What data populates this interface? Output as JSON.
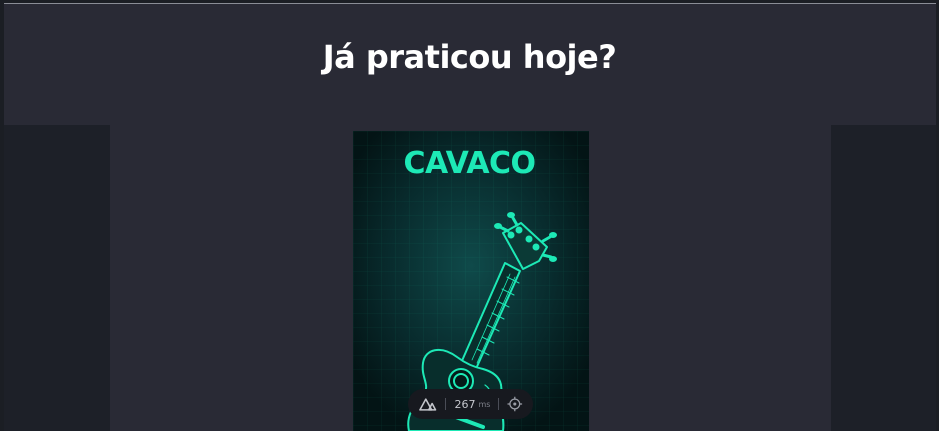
{
  "page": {
    "heading": "Já praticou hoje?"
  },
  "card": {
    "title": "CAVACO",
    "accent_color": "#1de9b6",
    "background_color": "#04191b",
    "illustration": "cavaquinho-icon"
  },
  "perf_badge": {
    "logo": "nuxt-logo-icon",
    "value": "267",
    "unit": "ms",
    "action_icon": "crosshair-icon"
  },
  "colors": {
    "page_background": "#292a35",
    "side_panels": "#1d2028",
    "heading_text": "#ffffff"
  }
}
